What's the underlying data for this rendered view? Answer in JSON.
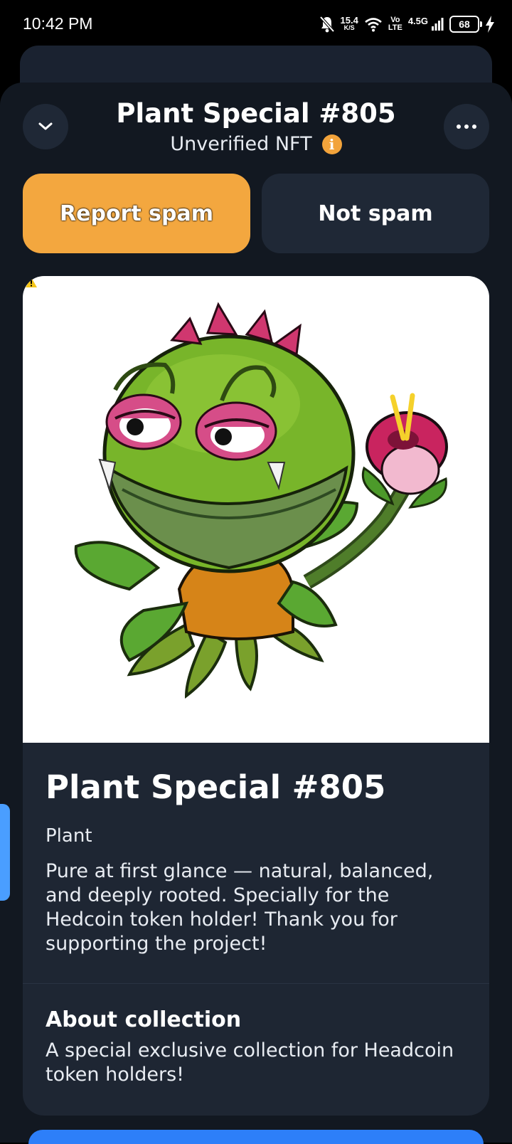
{
  "status_bar": {
    "time": "10:42 PM",
    "net_speed_value": "15.4",
    "net_speed_unit": "K/S",
    "volte_top": "Vo",
    "volte_bottom": "LTE",
    "network": "4.5G",
    "battery": "68",
    "icons": [
      "bell-off-icon",
      "wifi-icon",
      "signal-icon",
      "battery-icon",
      "charging-icon"
    ]
  },
  "header": {
    "title": "Plant Special #805",
    "subtitle": "Unverified NFT",
    "info_label": "i",
    "collapse_icon": "chevron-down-icon",
    "menu_icon": "more-horizontal-icon"
  },
  "actions": {
    "report_spam": "Report spam",
    "not_spam": "Not spam"
  },
  "nft": {
    "image_subject": "carnivorous plant character holding a flower",
    "name": "Plant Special #805",
    "category": "Plant",
    "description": "Pure at first glance — natural, balanced, and deeply rooted. Specially for the Hedcoin token holder! Thank you for supporting the project!"
  },
  "collection": {
    "heading": "About collection",
    "description": "A special exclusive collection for Headcoin token holders!"
  },
  "colors": {
    "background": "#121821",
    "card": "#1e2633",
    "accent_orange": "#f3a73f",
    "side_tab_blue": "#4a9eff"
  }
}
